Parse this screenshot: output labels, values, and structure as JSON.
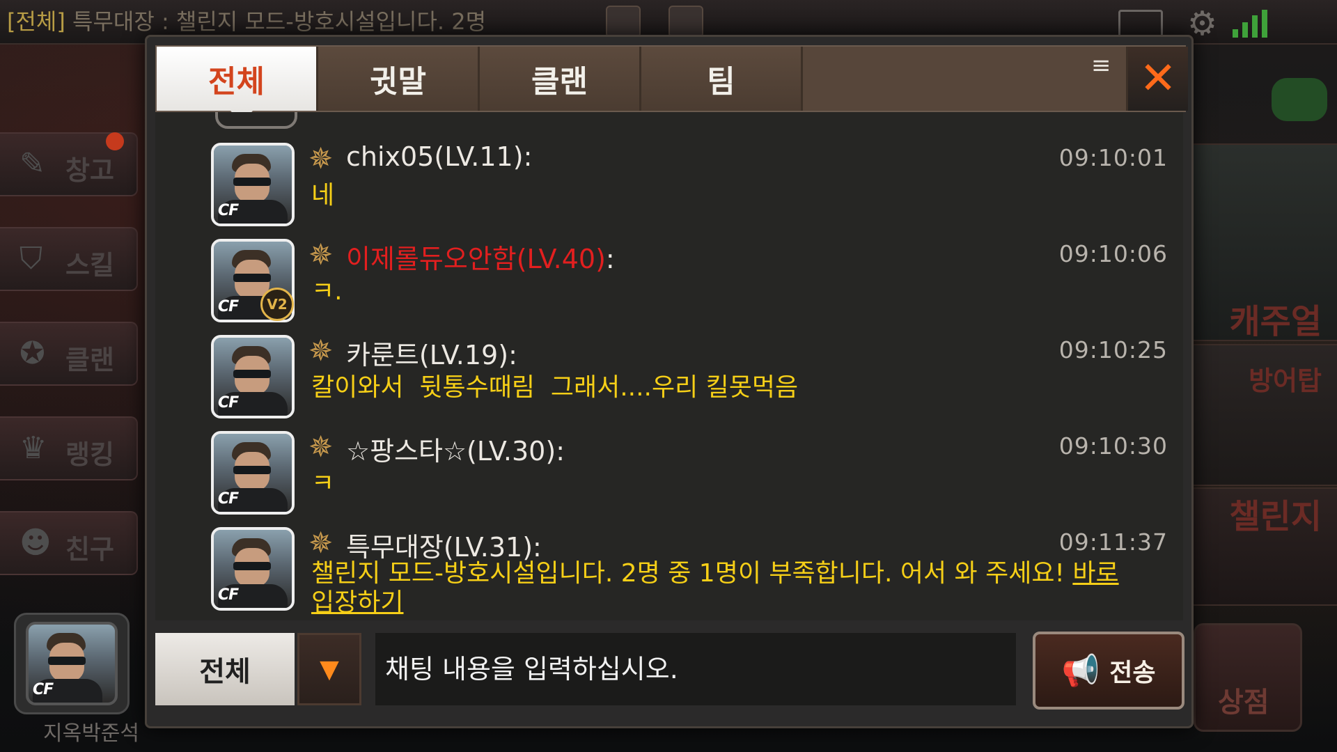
{
  "background": {
    "marquee_tag": "[전체]",
    "marquee_text": " 특무대장 : 챌린지 모드-방호시설입니다. 2명",
    "left_menu": [
      {
        "label": "창고",
        "icon": "warehouse-icon"
      },
      {
        "label": "스킬",
        "icon": "skill-icon"
      },
      {
        "label": "클랜",
        "icon": "clan-icon"
      },
      {
        "label": "랭킹",
        "icon": "ranking-icon"
      },
      {
        "label": "친구",
        "icon": "friends-icon"
      }
    ],
    "player_name": "지옥박준석",
    "right_panels": [
      {
        "label": "캐주얼"
      },
      {
        "label": "방어탑"
      },
      {
        "label": "챌린지"
      }
    ],
    "shop_label": "상점",
    "colors": {
      "signal": "#3fa23a",
      "gamepad": "#234d25",
      "notification": "#c63a1d"
    }
  },
  "chat": {
    "tabs": [
      {
        "label": "전체",
        "active": true
      },
      {
        "label": "귓말",
        "active": false
      },
      {
        "label": "클랜",
        "active": false
      },
      {
        "label": "팀",
        "active": false
      }
    ],
    "messages": [
      {
        "username": "chix05(LV.11)",
        "time": "09:10:01",
        "text": "네",
        "highlight": false,
        "badge": ""
      },
      {
        "username": "이제롤듀오안함(LV.40)",
        "time": "09:10:06",
        "text": "ㅋ.",
        "highlight": true,
        "badge": "V2"
      },
      {
        "username": "카룬트(LV.19)",
        "time": "09:10:25",
        "text": "칼이와서  뒷통수때림  그래서....우리 킬못먹음",
        "highlight": false,
        "badge": ""
      },
      {
        "username": "☆팡스타☆(LV.30)",
        "time": "09:10:30",
        "text": "ㅋ",
        "highlight": false,
        "badge": ""
      },
      {
        "username": "특무대장(LV.31)",
        "time": "09:11:37",
        "text": "챌린지 모드-방호시설입니다. 2명 중 1명이 부족합니다. 어서 와 주세요! ",
        "link": "바로 입장하기",
        "highlight": false,
        "badge": ""
      }
    ],
    "colon": ":",
    "avatar_logo": "CF",
    "input": {
      "scope": "전체",
      "placeholder": "채팅 내용을 입력하십시오."
    },
    "send_label": "전송",
    "colors": {
      "accent": "#ff6a1a",
      "message_text": "#f6cf17",
      "highlight_name": "#e21f1f",
      "tab_active_text": "#d3441d"
    }
  }
}
